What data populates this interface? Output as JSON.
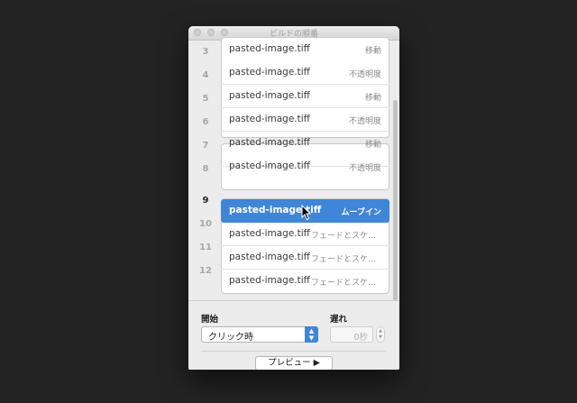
{
  "window": {
    "title": "ビルドの順番"
  },
  "builds": [
    {
      "num": "3",
      "name": "pasted-image.tiff",
      "effect": "移動"
    },
    {
      "num": "4",
      "name": "pasted-image.tiff",
      "effect": "不透明度"
    },
    {
      "num": "5",
      "name": "pasted-image.tiff",
      "effect": "移動"
    },
    {
      "num": "6",
      "name": "pasted-image.tiff",
      "effect": "不透明度"
    },
    {
      "num": "7",
      "name": "pasted-image.tiff",
      "effect": "移動"
    },
    {
      "num": "8",
      "name": "pasted-image.tiff",
      "effect": "不透明度"
    },
    {
      "num": "9",
      "name": "pasted-image.tiff",
      "effect": "ムーブイン",
      "selected": true
    },
    {
      "num": "10",
      "name": "pasted-image.tiff",
      "effect": "フェードとスケール"
    },
    {
      "num": "11",
      "name": "pasted-image.tiff",
      "effect": "フェードとスケール"
    },
    {
      "num": "12",
      "name": "pasted-image.tiff",
      "effect": "フェードとスケール"
    }
  ],
  "controls": {
    "start_label": "開始",
    "start_value": "クリック時",
    "delay_label": "遅れ",
    "delay_value": "0秒",
    "preview_label": "プレビュー ▶"
  },
  "colors": {
    "selection": "#3f86d9",
    "background": "#232323"
  }
}
